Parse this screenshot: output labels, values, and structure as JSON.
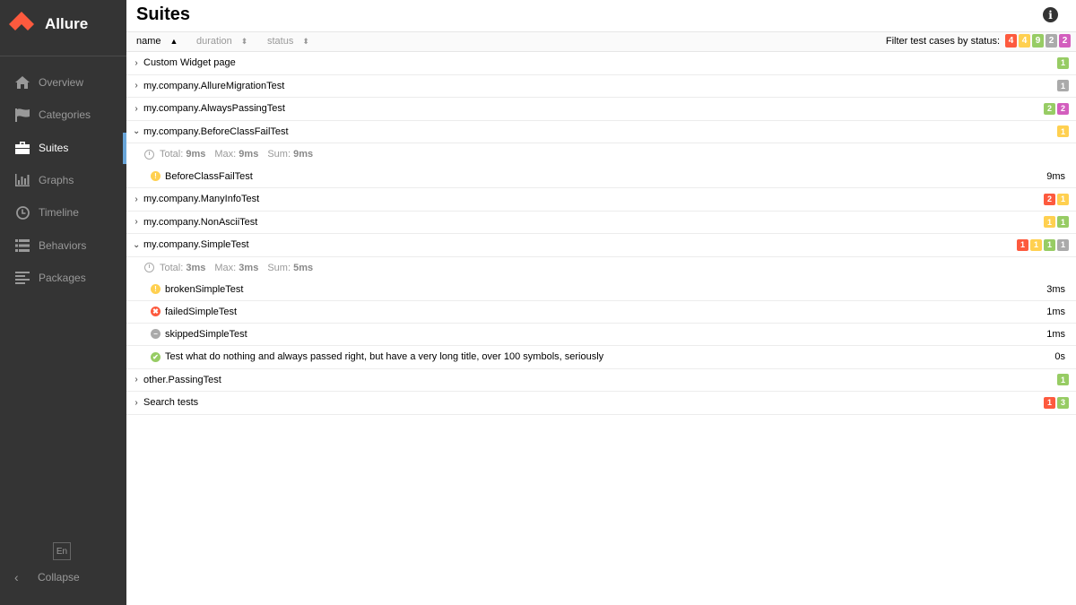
{
  "app": {
    "name": "Allure"
  },
  "sidebar": {
    "items": [
      {
        "label": "Overview",
        "icon": "home-icon",
        "active": false
      },
      {
        "label": "Categories",
        "icon": "flag-icon",
        "active": false
      },
      {
        "label": "Suites",
        "icon": "briefcase-icon",
        "active": true
      },
      {
        "label": "Graphs",
        "icon": "bar-chart-icon",
        "active": false
      },
      {
        "label": "Timeline",
        "icon": "clock-icon",
        "active": false
      },
      {
        "label": "Behaviors",
        "icon": "list-icon",
        "active": false
      },
      {
        "label": "Packages",
        "icon": "align-left-icon",
        "active": false
      }
    ],
    "language": "En",
    "collapse_label": "Collapse"
  },
  "page": {
    "title": "Suites",
    "sort": {
      "name": "name",
      "duration": "duration",
      "status": "status"
    },
    "filter_label": "Filter test cases by status:",
    "filter_badges": [
      {
        "count": "4",
        "status": "failed"
      },
      {
        "count": "4",
        "status": "broken"
      },
      {
        "count": "9",
        "status": "passed"
      },
      {
        "count": "2",
        "status": "skipped"
      },
      {
        "count": "2",
        "status": "unknown"
      }
    ]
  },
  "groups": [
    {
      "name": "Custom Widget page",
      "expanded": false,
      "badges": [
        {
          "c": "1",
          "s": "passed"
        }
      ]
    },
    {
      "name": "my.company.AllureMigrationTest",
      "expanded": false,
      "badges": [
        {
          "c": "1",
          "s": "skipped"
        }
      ]
    },
    {
      "name": "my.company.AlwaysPassingTest",
      "expanded": false,
      "badges": [
        {
          "c": "2",
          "s": "passed"
        },
        {
          "c": "2",
          "s": "unknown"
        }
      ]
    },
    {
      "name": "my.company.BeforeClassFailTest",
      "expanded": true,
      "badges": [
        {
          "c": "1",
          "s": "broken"
        }
      ],
      "stats": {
        "total_label": "Total:",
        "total": "9ms",
        "max_label": "Max:",
        "max": "9ms",
        "sum_label": "Sum:",
        "sum": "9ms"
      },
      "tests": [
        {
          "name": "BeforeClassFailTest",
          "status": "broken",
          "duration": "9ms"
        }
      ]
    },
    {
      "name": "my.company.ManyInfoTest",
      "expanded": false,
      "badges": [
        {
          "c": "2",
          "s": "failed"
        },
        {
          "c": "1",
          "s": "broken"
        }
      ]
    },
    {
      "name": "my.company.NonAsciiTest",
      "expanded": false,
      "badges": [
        {
          "c": "1",
          "s": "broken"
        },
        {
          "c": "1",
          "s": "passed"
        }
      ]
    },
    {
      "name": "my.company.SimpleTest",
      "expanded": true,
      "badges": [
        {
          "c": "1",
          "s": "failed"
        },
        {
          "c": "1",
          "s": "broken"
        },
        {
          "c": "1",
          "s": "passed"
        },
        {
          "c": "1",
          "s": "skipped"
        }
      ],
      "stats": {
        "total_label": "Total:",
        "total": "3ms",
        "max_label": "Max:",
        "max": "3ms",
        "sum_label": "Sum:",
        "sum": "5ms"
      },
      "tests": [
        {
          "name": "brokenSimpleTest",
          "status": "broken",
          "duration": "3ms"
        },
        {
          "name": "failedSimpleTest",
          "status": "failed",
          "duration": "1ms"
        },
        {
          "name": "skippedSimpleTest",
          "status": "skipped",
          "duration": "1ms"
        },
        {
          "name": "Test what do nothing and always passed right, but have a very long title, over 100 symbols, seriously",
          "status": "passed",
          "duration": "0s"
        }
      ]
    },
    {
      "name": "other.PassingTest",
      "expanded": false,
      "badges": [
        {
          "c": "1",
          "s": "passed"
        }
      ]
    },
    {
      "name": "Search tests",
      "expanded": false,
      "badges": [
        {
          "c": "1",
          "s": "failed"
        },
        {
          "c": "3",
          "s": "passed"
        }
      ]
    }
  ],
  "colors": {
    "failed": "#fd5a3e",
    "broken": "#ffd050",
    "passed": "#97cc64",
    "skipped": "#aaaaaa",
    "unknown": "#d35ebe",
    "sidebar_bg": "#343434",
    "active_indicator": "#69a5d8"
  }
}
